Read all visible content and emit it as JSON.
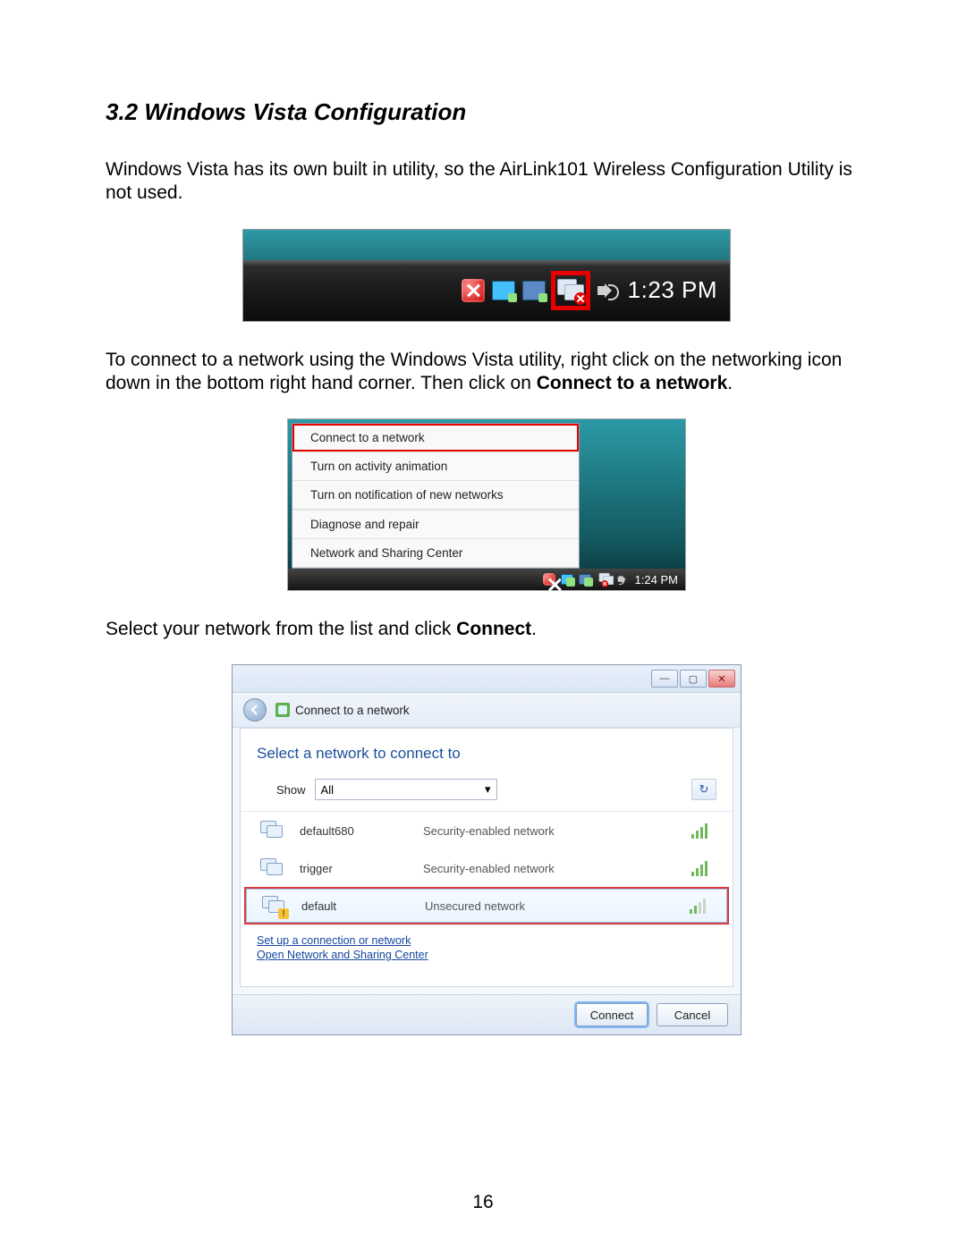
{
  "heading": "3.2 Windows Vista Configuration",
  "para1": "Windows Vista has its own built in utility, so the AirLink101 Wireless Configuration Utility is not used.",
  "tray": {
    "clock": "1:23 PM"
  },
  "para2a": "To connect to a network using the Windows Vista utility, right click on the networking icon down in the bottom right hand corner.  Then click on ",
  "para2b": "Connect to a network",
  "para2c": ".",
  "ctx": {
    "items": [
      "Connect to a network",
      "Turn on activity animation",
      "Turn on notification of new networks",
      "Diagnose and repair",
      "Network and Sharing Center"
    ],
    "clock": "1:24 PM"
  },
  "para3a": "Select your network from the list and click ",
  "para3b": "Connect",
  "para3c": ".",
  "win": {
    "nav_title": "Connect to a network",
    "prompt": "Select a network to connect to",
    "show_label": "Show",
    "show_value": "All",
    "networks": [
      {
        "name": "default680",
        "security": "Security-enabled network",
        "selected": false,
        "warn": false,
        "strength": "full"
      },
      {
        "name": "trigger",
        "security": "Security-enabled network",
        "selected": false,
        "warn": false,
        "strength": "full"
      },
      {
        "name": "default",
        "security": "Unsecured network",
        "selected": true,
        "warn": true,
        "strength": "weak"
      }
    ],
    "link1": "Set up a connection or network",
    "link2": "Open Network and Sharing Center",
    "btn_connect": "Connect",
    "btn_cancel": "Cancel",
    "winbtn_min": "—",
    "winbtn_max": "▢",
    "winbtn_close": "✕"
  },
  "page_number": "16"
}
